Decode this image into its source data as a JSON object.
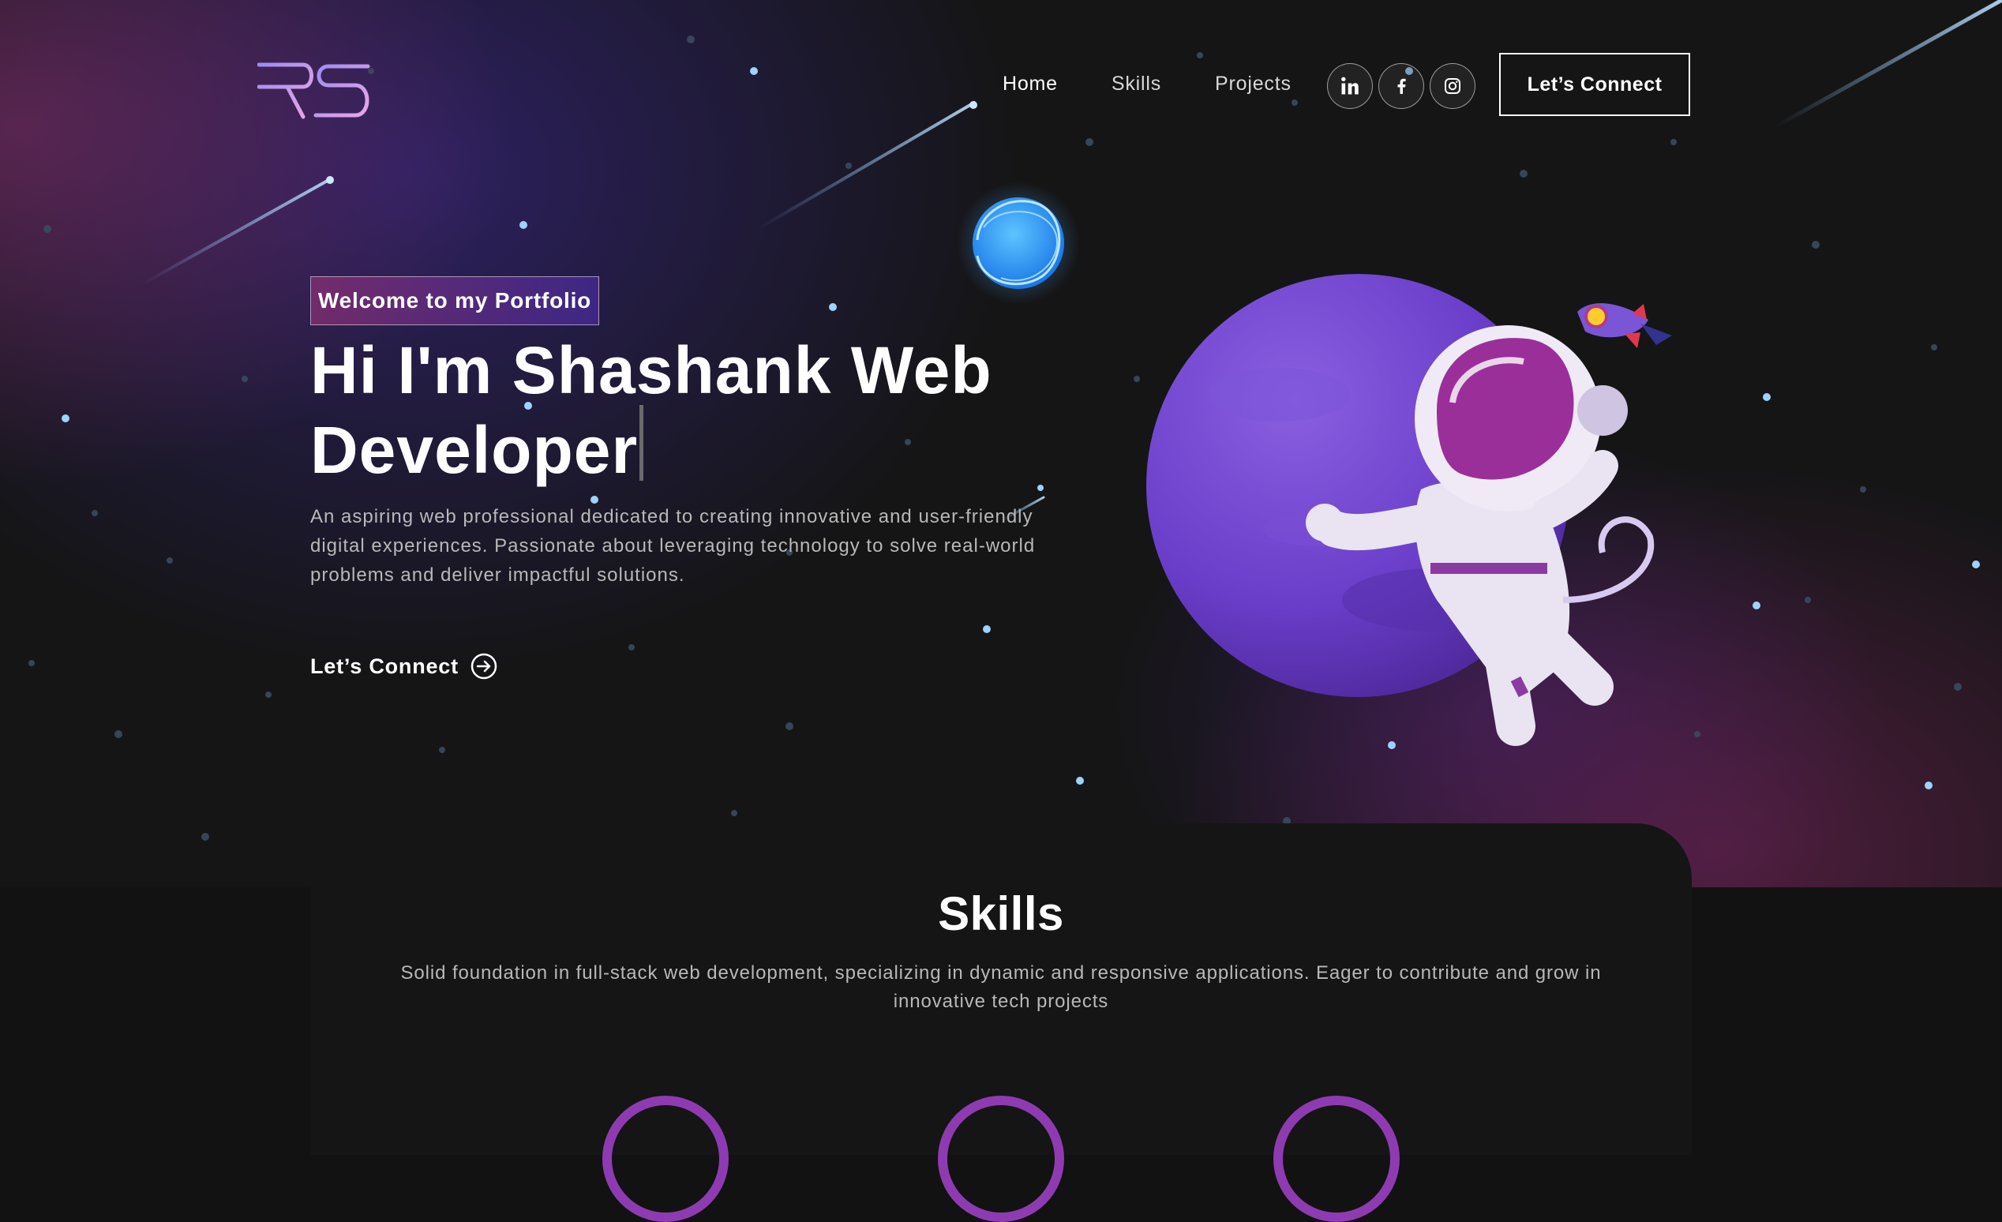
{
  "nav": {
    "logo_text": "RS",
    "links": [
      {
        "label": "Home"
      },
      {
        "label": "Skills"
      },
      {
        "label": "Projects"
      }
    ],
    "social": [
      {
        "icon": "linkedin-icon",
        "glyph": "in"
      },
      {
        "icon": "facebook-icon",
        "glyph": "f"
      },
      {
        "icon": "instagram-icon",
        "glyph": ""
      }
    ],
    "connect_label": "Let’s Connect"
  },
  "hero": {
    "tagline": "Welcome to my Portfolio",
    "headline": "Hi I'm Shashank Web Developer",
    "description": "An aspiring web professional dedicated to creating innovative and user-friendly digital experiences. Passionate about leveraging technology to solve real-world problems and deliver impactful solutions.",
    "cta_label": "Let’s Connect"
  },
  "skills": {
    "title": "Skills",
    "description": "Solid foundation in full-stack web development, specializing in dynamic and responsive applications. Eager to contribute and grow in innovative tech projects"
  },
  "colors": {
    "background": "#121212",
    "accent_pink": "#aa367c",
    "accent_purple": "#4a2fbd",
    "text_muted": "#b8b8b8"
  }
}
